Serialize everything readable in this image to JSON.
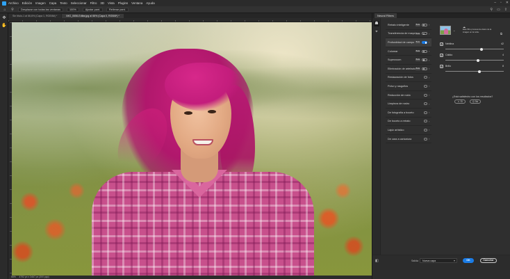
{
  "menubar": {
    "items": [
      "Archivo",
      "Edición",
      "Imagen",
      "Capa",
      "Texto",
      "Seleccionar",
      "Filtro",
      "3D",
      "Vista",
      "Plugins",
      "Ventana",
      "Ayuda"
    ]
  },
  "optbar": {
    "sample_all": "Desplazar con todas las ventanas",
    "zoom": "100%",
    "fit_screen": "Ajustar pant.",
    "fill_screen": "Rellenar pant."
  },
  "tabs": [
    {
      "label": "Sin título-1 al 66,6% (Capa 1, RGB/8#) *"
    },
    {
      "label": "IMG_0656-Editar.jpg al 66% (Capa 0, RGB/8*) *"
    }
  ],
  "status": {
    "text": "4792 px x 3467 px (300 ppp)",
    "zoom": "66%"
  },
  "neural_filters": {
    "title": "Neural Filters",
    "filters": [
      {
        "label": "Retrato inteligente",
        "beta": "Beta",
        "on": false
      },
      {
        "label": "Transferencia de maquillaje",
        "beta": "Beta",
        "on": false
      },
      {
        "label": "Profundidad de campo",
        "beta": "Beta",
        "on": true
      },
      {
        "label": "Colorear",
        "beta": "Beta",
        "on": false
      },
      {
        "label": "Superzoom",
        "beta": "Beta",
        "on": false
      },
      {
        "label": "Eliminación de artefactos JPEG",
        "beta": "Beta",
        "on": false
      },
      {
        "label": "Restauración de fotos",
        "beta": "",
        "on": null
      },
      {
        "label": "Polvo y rasguños",
        "beta": "",
        "on": null
      },
      {
        "label": "Reducción de ruido",
        "beta": "",
        "on": null
      },
      {
        "label": "Limpieza de rostro",
        "beta": "",
        "on": null
      },
      {
        "label": "De fotografía a boceto",
        "beta": "",
        "on": null
      },
      {
        "label": "De boceto a retrato",
        "beta": "",
        "on": null
      },
      {
        "label": "Lápiz artístico",
        "beta": "",
        "on": null
      },
      {
        "label": "De cara a caricatura",
        "beta": "",
        "on": null
      }
    ],
    "detail": {
      "description": "Este filtro procesa los datos de la imagen en la nube.",
      "sliders": [
        {
          "label": "Neblina",
          "value": "42",
          "fraction": 0.62
        },
        {
          "label": "Cálido",
          "value": "4",
          "fraction": 0.56
        },
        {
          "label": "Brillo",
          "value": "8",
          "fraction": 0.58
        }
      ],
      "feedback_question": "¿Está satisfecho con los resultados?",
      "yes": "Sí",
      "no": "No"
    },
    "footer": {
      "output_label": "Salida",
      "output_value": "Nueva capa",
      "ok": "OK",
      "cancel": "Cancelar"
    }
  }
}
